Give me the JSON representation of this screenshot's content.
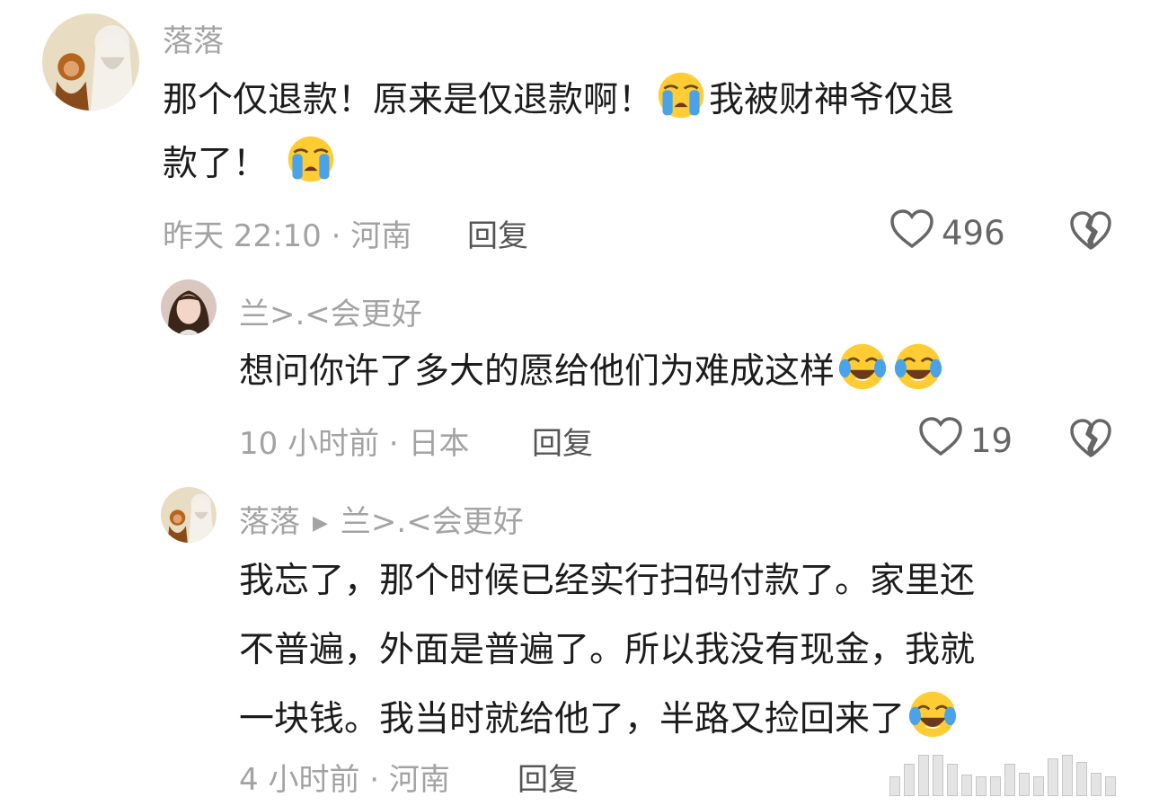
{
  "comments": [
    {
      "username": "落落",
      "text_line1": "那个仅退款！原来是仅退款啊！",
      "text_line1b": "我被财神爷仅退",
      "text_line2": "款了！",
      "time_location": "昨天 22:10 · 河南",
      "reply_label": "回复",
      "likes": "496"
    },
    {
      "username": "兰>.<会更好",
      "text": "想问你许了多大的愿给他们为难成这样",
      "time_location": "10 小时前 · 日本",
      "reply_label": "回复",
      "likes": "19"
    },
    {
      "username": "落落",
      "reply_to": "兰>.<会更好",
      "text_line1": "我忘了，那个时候已经实行扫码付款了。家里还",
      "text_line2": "不普遍，外面是普遍了。所以我没有现金，我就",
      "text_line3": "一块钱。我当时就给他了，半路又捡回来了",
      "time_location": "4 小时前 · 河南",
      "reply_label": "回复"
    }
  ],
  "icons": {
    "like": "heart-outline-icon",
    "dislike": "broken-heart-icon",
    "crying": "loudly-crying-emoji",
    "tears_of_joy": "crying-laughing-emoji",
    "reply_arrow": "play-triangle-icon"
  },
  "colors": {
    "text": "#1c1c1c",
    "muted": "#a3a3a3",
    "reply": "#555555"
  }
}
